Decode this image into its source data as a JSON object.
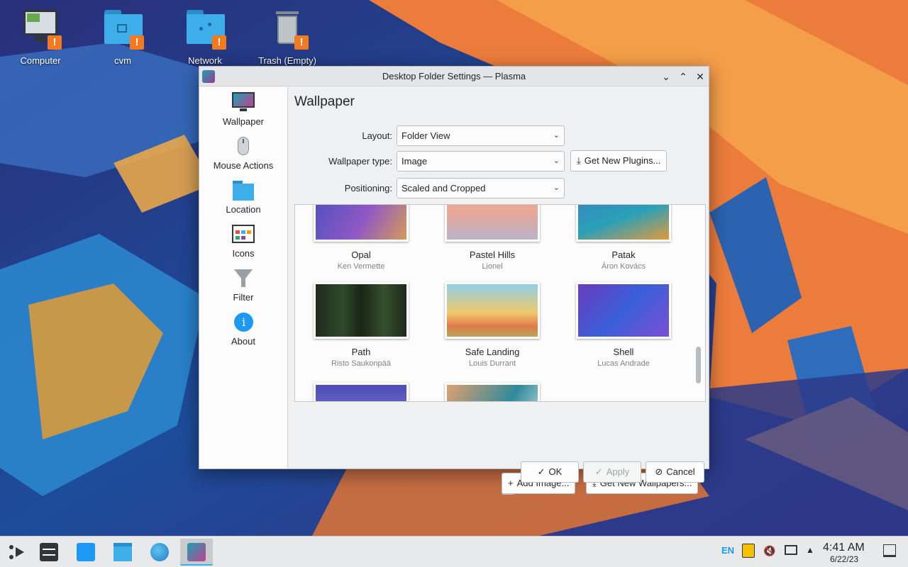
{
  "desktop": {
    "icons": [
      {
        "label": "Computer"
      },
      {
        "label": "cvm"
      },
      {
        "label": "Network"
      },
      {
        "label": "Trash (Empty)"
      }
    ],
    "warning_glyph": "!"
  },
  "dialog": {
    "title": "Desktop Folder Settings — Plasma",
    "window_buttons": {
      "minimize": "⌄",
      "maximize": "⌃",
      "close": "✕"
    },
    "sidebar": [
      {
        "label": "Wallpaper",
        "icon": "monitor-icon"
      },
      {
        "label": "Mouse Actions",
        "icon": "mouse-icon"
      },
      {
        "label": "Location",
        "icon": "folder-icon"
      },
      {
        "label": "Icons",
        "icon": "icons-grid-icon"
      },
      {
        "label": "Filter",
        "icon": "funnel-icon"
      },
      {
        "label": "About",
        "icon": "info-icon"
      }
    ],
    "heading": "Wallpaper",
    "form": {
      "layout_label": "Layout:",
      "layout_value": "Folder View",
      "type_label": "Wallpaper type:",
      "type_value": "Image",
      "get_plugins": "Get New Plugins...",
      "positioning_label": "Positioning:",
      "positioning_value": "Scaled and Cropped"
    },
    "wallpapers": [
      {
        "name": "Opal",
        "author": "Ken Vermette"
      },
      {
        "name": "Pastel Hills",
        "author": "Lionel"
      },
      {
        "name": "Patak",
        "author": "Áron Kovács"
      },
      {
        "name": "Path",
        "author": "Risto Saukonpää"
      },
      {
        "name": "Safe Landing",
        "author": "Louis Durrant"
      },
      {
        "name": "Shell",
        "author": "Lucas Andrade"
      }
    ],
    "buttons": {
      "add_image": "Add Image...",
      "get_wallpapers": "Get New Wallpapers...",
      "ok": "OK",
      "apply": "Apply",
      "cancel": "Cancel"
    }
  },
  "taskbar": {
    "tray": {
      "keyboard_layout": "EN"
    },
    "clock": {
      "time": "4:41 AM",
      "date": "6/22/23"
    }
  },
  "colors": {
    "accent": "#3daee9",
    "warning": "#f47a20",
    "folder": "#3daee9"
  }
}
